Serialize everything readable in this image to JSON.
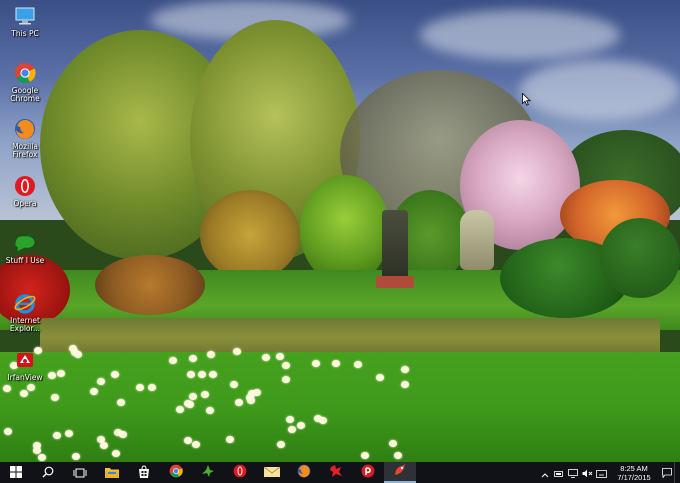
{
  "desktop": {
    "icons": [
      {
        "label": "This PC",
        "icon": "this-pc-icon"
      },
      {
        "label": "Google Chrome",
        "icon": "chrome-icon"
      },
      {
        "label": "Mozilla Firefox",
        "icon": "firefox-icon"
      },
      {
        "label": "Opera",
        "icon": "opera-icon"
      },
      {
        "label": "Stuff I Use",
        "icon": "folder-shortcut-icon"
      },
      {
        "label": "Internet Explor...",
        "icon": "internet-explorer-icon"
      },
      {
        "label": "IrfanView",
        "icon": "irfanview-icon"
      }
    ]
  },
  "taskbar": {
    "apps": [
      {
        "name": "start",
        "icon": "windows-start-icon"
      },
      {
        "name": "search",
        "icon": "search-icon"
      },
      {
        "name": "task-view",
        "icon": "task-view-icon"
      },
      {
        "name": "file-explorer",
        "icon": "file-explorer-icon"
      },
      {
        "name": "store",
        "icon": "store-icon"
      },
      {
        "name": "chrome",
        "icon": "chrome-icon"
      },
      {
        "name": "app-green",
        "icon": "green-app-icon"
      },
      {
        "name": "opera",
        "icon": "opera-icon"
      },
      {
        "name": "mail",
        "icon": "mail-icon"
      },
      {
        "name": "firefox",
        "icon": "firefox-icon"
      },
      {
        "name": "app-red",
        "icon": "red-app-icon"
      },
      {
        "name": "app-record",
        "icon": "red-circle-app-icon"
      },
      {
        "name": "app-active",
        "icon": "active-app-icon"
      }
    ],
    "clock": {
      "time": "8:25 AM",
      "date": "7/17/2015"
    }
  },
  "colors": {
    "taskbar_bg": "#101217",
    "taskbar_accent": "#8fb1d8",
    "icon_label": "#ffffff"
  }
}
